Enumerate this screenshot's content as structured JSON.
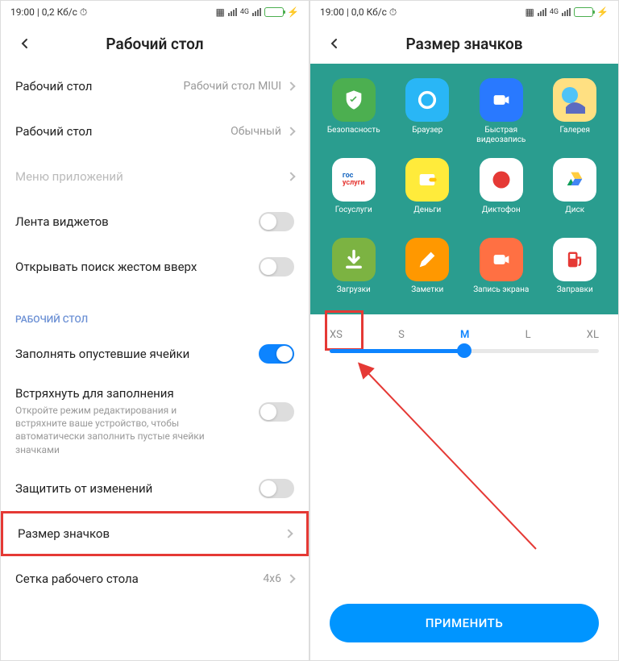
{
  "left": {
    "status": {
      "time": "19:00",
      "speed": "0,2 Кб/с"
    },
    "title": "Рабочий стол",
    "rows": {
      "desktop_type": {
        "label": "Рабочий стол",
        "value": "Рабочий стол MIUI"
      },
      "desktop_mode": {
        "label": "Рабочий стол",
        "value": "Обычный"
      },
      "app_menu": {
        "label": "Меню приложений"
      },
      "widget_feed": {
        "label": "Лента виджетов"
      },
      "search_gesture": {
        "label": "Открывать поиск жестом вверх"
      },
      "section": "РАБОЧИЙ СТОЛ",
      "fill_empty": {
        "label": "Заполнять опустевшие ячейки"
      },
      "shake": {
        "label": "Встряхнуть для заполнения",
        "desc": "Откройте режим редактирования и встряхните ваше устройство, чтобы автоматически заполнить пустые ячейки значками"
      },
      "lock": {
        "label": "Защитить от изменений"
      },
      "icon_size": {
        "label": "Размер значков"
      },
      "grid": {
        "label": "Сетка рабочего стола",
        "value": "4x6"
      }
    }
  },
  "right": {
    "status": {
      "time": "19:00",
      "speed": "0,0 Кб/с"
    },
    "title": "Размер значков",
    "apps": [
      {
        "label": "Безопасность",
        "bg": "#4caf50",
        "glyph": "shield"
      },
      {
        "label": "Браузер",
        "bg": "#29b6f6",
        "glyph": "circle"
      },
      {
        "label": "Быстрая видеозапись",
        "bg": "#2979ff",
        "glyph": "camera"
      },
      {
        "label": "Галерея",
        "bg": "#ffe082",
        "glyph": "gallery"
      },
      {
        "label": "Госуслуги",
        "bg": "#fff",
        "glyph": "gos"
      },
      {
        "label": "Деньги",
        "bg": "#ffeb3b",
        "glyph": "wallet"
      },
      {
        "label": "Диктофон",
        "bg": "#fff",
        "glyph": "rec"
      },
      {
        "label": "Диск",
        "bg": "#fff",
        "glyph": "drive"
      },
      {
        "label": "Загрузки",
        "bg": "#7cb342",
        "glyph": "down"
      },
      {
        "label": "Заметки",
        "bg": "#ff9800",
        "glyph": "note"
      },
      {
        "label": "Запись экрана",
        "bg": "#ff7043",
        "glyph": "screen"
      },
      {
        "label": "Заправки",
        "bg": "#fff",
        "glyph": "fuel"
      }
    ],
    "sizes": {
      "xs": "XS",
      "s": "S",
      "m": "M",
      "l": "L",
      "xl": "XL"
    },
    "apply": "ПРИМЕНИТЬ"
  }
}
